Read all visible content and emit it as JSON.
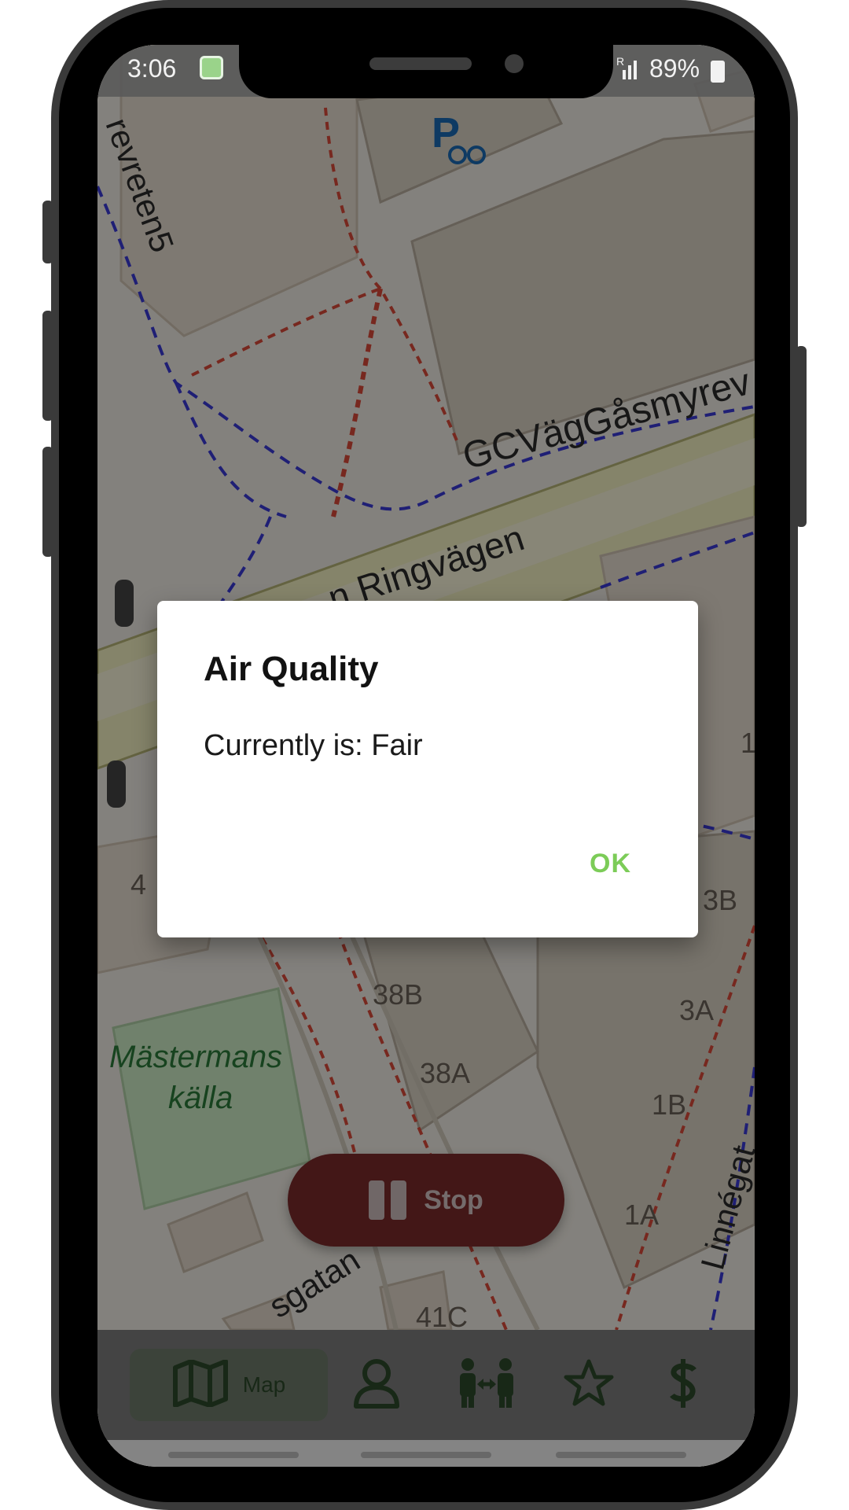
{
  "status_bar": {
    "time": "3:06",
    "battery": "89%",
    "signal": "R"
  },
  "map": {
    "labels": {
      "street_gcvag": "GCVägGåsmyrev",
      "street_ringvagen": "n Ringvägen",
      "street_revreten": "revreten5",
      "street_linnegatan": "Linnégat",
      "street_gatan": "sgatan",
      "park": "Mästermans",
      "park_2": "källa",
      "b38b": "38B",
      "b38a": "38A",
      "b3b": "3B",
      "b3a": "3A",
      "b1b": "1B",
      "b1a": "1A",
      "b41c": "41C",
      "b1": "1",
      "b4": "4"
    }
  },
  "stop_button": {
    "label": "Stop"
  },
  "dialog": {
    "title": "Air Quality",
    "message": "Currently is: Fair",
    "ok_label": "OK"
  },
  "nav": {
    "map_label": "Map"
  },
  "colors": {
    "accent_green": "#7ccc58",
    "nav_green": "#2d4a2a",
    "stop_red": "#7a2a2a"
  }
}
